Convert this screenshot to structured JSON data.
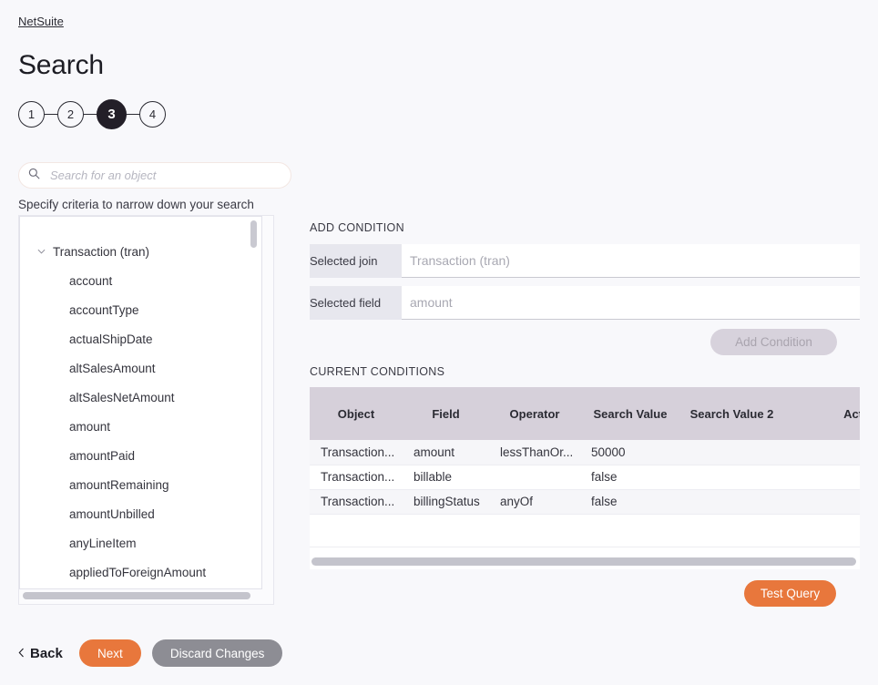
{
  "breadcrumb": {
    "label": "NetSuite"
  },
  "page_title": "Search",
  "stepper": {
    "steps": [
      {
        "label": "1",
        "active": false
      },
      {
        "label": "2",
        "active": false
      },
      {
        "label": "3",
        "active": true
      },
      {
        "label": "4",
        "active": false
      }
    ],
    "active_step": "3"
  },
  "search": {
    "placeholder": "Search for an object",
    "value": "",
    "icon": "search-icon"
  },
  "criteria_hint": "Specify criteria to narrow down your search",
  "object_tree": {
    "root": {
      "label": "Transaction (tran)",
      "expanded": true,
      "chevron": "chevron-down-icon"
    },
    "children": [
      "account",
      "accountType",
      "actualShipDate",
      "altSalesAmount",
      "altSalesNetAmount",
      "amount",
      "amountPaid",
      "amountRemaining",
      "amountUnbilled",
      "anyLineItem",
      "appliedToForeignAmount"
    ]
  },
  "add_condition": {
    "section_label": "ADD CONDITION",
    "fields": [
      {
        "label": "Selected join",
        "value": "Transaction (tran)"
      },
      {
        "label": "Selected field",
        "value": "amount"
      }
    ],
    "button_label": "Add Condition",
    "button_disabled": true
  },
  "current_conditions": {
    "section_label": "CURRENT CONDITIONS",
    "columns": [
      "Object",
      "Field",
      "Operator",
      "Search Value",
      "Search Value 2",
      "Actions"
    ],
    "rows": [
      {
        "object": "Transaction...",
        "field": "amount",
        "operator": "lessThanOr...",
        "search_value": "50000",
        "search_value_2": "",
        "actions": ""
      },
      {
        "object": "Transaction...",
        "field": "billable",
        "operator": "",
        "search_value": "false",
        "search_value_2": "",
        "actions": ""
      },
      {
        "object": "Transaction...",
        "field": "billingStatus",
        "operator": "anyOf",
        "search_value": "false",
        "search_value_2": "",
        "actions": ""
      }
    ]
  },
  "test_query": {
    "label": "Test Query"
  },
  "footer": {
    "back_label": "Back",
    "next_label": "Next",
    "discard_label": "Discard Changes"
  },
  "colors": {
    "accent_orange": "#e8773c",
    "discard_gray": "#8d8d94",
    "step_active": "#231f28",
    "table_header": "#d6d0da",
    "page_bg": "#f8f8fb"
  }
}
